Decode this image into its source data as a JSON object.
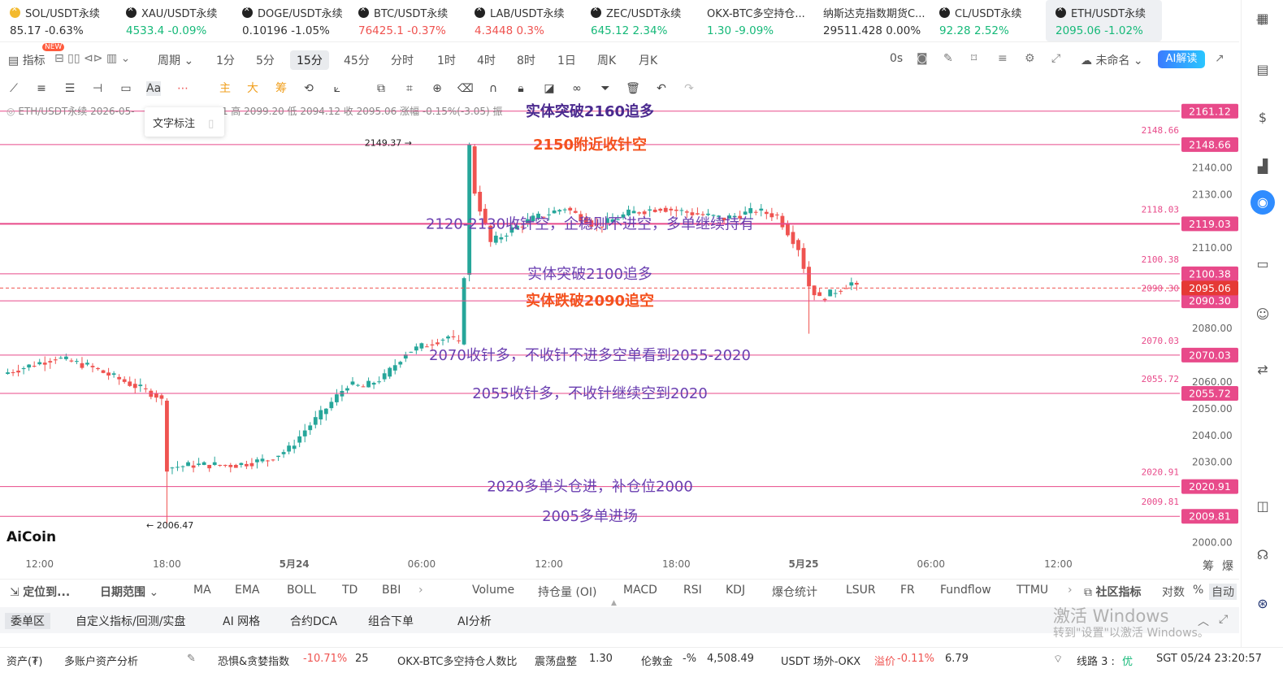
{
  "tickers": [
    {
      "name": "SOL/USDT永续",
      "price": "85.17",
      "change": "-0.63%",
      "color": "#333333",
      "icon": "sol-coin-icon"
    },
    {
      "name": "XAU/USDT永续",
      "price": "4533.4",
      "change": "-0.09%",
      "color": "#16b979",
      "icon": "okx-coin-icon"
    },
    {
      "name": "DOGE/USDT永续",
      "price": "0.10196",
      "change": "-1.05%",
      "color": "#333333",
      "icon": "okx-coin-icon"
    },
    {
      "name": "BTC/USDT永续",
      "price": "76425.1",
      "change": "-0.37%",
      "color": "#ef5350",
      "icon": "okx-coin-icon"
    },
    {
      "name": "LAB/USDT永续",
      "price": "4.3448",
      "change": "0.3%",
      "color": "#ef5350",
      "icon": "okx-coin-icon"
    },
    {
      "name": "ZEC/USDT永续",
      "price": "645.12",
      "change": "2.34%",
      "color": "#16b979",
      "icon": "okx-coin-icon"
    },
    {
      "name": "OKX-BTC多空持仓...",
      "price": "1.30",
      "change": "-9.09%",
      "color": "#16b979",
      "icon": ""
    },
    {
      "name": "纳斯达克指数期货C...",
      "price": "29511.428",
      "change": "0.00%",
      "color": "#333333",
      "icon": ""
    },
    {
      "name": "CL/USDT永续",
      "price": "92.28",
      "change": "2.52%",
      "color": "#16b979",
      "icon": "okx-coin-icon"
    },
    {
      "name": "ETH/USDT永续",
      "price": "2095.06",
      "change": "-1.02%",
      "color": "#16b979",
      "icon": "okx-coin-icon",
      "active": true
    }
  ],
  "toolbar": {
    "indicators": "指标",
    "new_badge": "NEW",
    "period": "周期",
    "intervals": [
      "1分",
      "5分",
      "15分",
      "45分",
      "分时",
      "1时",
      "4时",
      "8时",
      "1日",
      "周K",
      "月K"
    ],
    "selected_interval": "15分",
    "countdown": "0s",
    "layout_name": "未命名",
    "ai_button": "AI解读"
  },
  "legend": {
    "text": "ETH/USDT永续  2026-05-",
    "ohlc": ".11 高 2099.20  低 2094.12  收 2095.06  涨幅 -0.15%(-3.05)  振"
  },
  "popup": {
    "label": "文字标注"
  },
  "chart_data": {
    "type": "candlestick",
    "symbol": "ETH/USDT永续",
    "interval": "15分",
    "ylim": [
      1995,
      2165
    ],
    "y_ticks": [
      2000,
      2010,
      2020,
      2030,
      2040,
      2050,
      2060,
      2070,
      2080,
      2090,
      2100,
      2110,
      2120,
      2130,
      2140
    ],
    "x_ticks": [
      {
        "label": "12:00",
        "bar": 7
      },
      {
        "label": "18:00",
        "bar": 31
      },
      {
        "label": "5月24",
        "bar": 55
      },
      {
        "label": "06:00",
        "bar": 79
      },
      {
        "label": "12:00",
        "bar": 103
      },
      {
        "label": "18:00",
        "bar": 127
      },
      {
        "label": "5月25",
        "bar": 151
      },
      {
        "label": "06:00",
        "bar": 175
      },
      {
        "label": "12:00",
        "bar": 199
      }
    ],
    "bars_visible": 216,
    "price_levels": [
      {
        "value": 2161.12,
        "label": "2161.12"
      },
      {
        "value": 2148.66,
        "label": "2148.66",
        "side_label": "2148.66"
      },
      {
        "value": 2119.03,
        "label": "2119.03",
        "side_label": "2118.03"
      },
      {
        "value": 2100.38,
        "label": "2100.38",
        "side_label": "2100.38"
      },
      {
        "value": 2090.3,
        "label": "2090.30"
      },
      {
        "value": 2070.03,
        "label": "2070.03",
        "side_label": "2070.03"
      },
      {
        "value": 2055.72,
        "label": "2055.72",
        "side_label": "2055.72"
      },
      {
        "value": 2020.91,
        "label": "2020.91",
        "side_label": "2020.91"
      },
      {
        "value": 2009.81,
        "label": "2009.81",
        "side_label": "2009.81"
      }
    ],
    "current_price": {
      "value": 2095.06,
      "label": "2095.06",
      "side_label": "2090.30"
    },
    "annotations": [
      {
        "text": "实体突破2160追多",
        "price": 2161.12,
        "color": "#4b2a8f"
      },
      {
        "text": "2150附近收针空",
        "price": 2148.66,
        "color": "#f4511e"
      },
      {
        "text": "2120-2130收针空，企稳则不进空，多单继续持有",
        "price": 2119.03,
        "color": "#6a3fb0"
      },
      {
        "text": "实体突破2100追多",
        "price": 2100.38,
        "color": "#6a3fb0"
      },
      {
        "text": "实体跌破2090追空",
        "price": 2090.3,
        "color": "#f4511e"
      },
      {
        "text": "2070收针多，不收针不进多空单看到2055-2020",
        "price": 2070.03,
        "color": "#6a3fb0"
      },
      {
        "text": "2055收针多，不收针继续空到2020",
        "price": 2055.72,
        "color": "#6a3fb0"
      },
      {
        "text": "2020多单头仓进，补仓位2000",
        "price": 2020.91,
        "color": "#6a3fb0"
      },
      {
        "text": "2005多单进场",
        "price": 2009.81,
        "color": "#6a3fb0"
      }
    ],
    "marks": [
      {
        "text": "2149.37",
        "price": 2149.37
      },
      {
        "text": "2006.47",
        "price": 2006.47
      }
    ],
    "key_points": [
      [
        0,
        2063
      ],
      [
        10,
        2069
      ],
      [
        16,
        2066
      ],
      [
        22,
        2061
      ],
      [
        29,
        2055
      ],
      [
        30,
        2053
      ],
      [
        31,
        2028
      ],
      [
        36,
        2029
      ],
      [
        44,
        2029
      ],
      [
        50,
        2031
      ],
      [
        54,
        2035
      ],
      [
        57,
        2042
      ],
      [
        60,
        2048
      ],
      [
        65,
        2059
      ],
      [
        68,
        2058
      ],
      [
        72,
        2062
      ],
      [
        76,
        2071
      ],
      [
        80,
        2074
      ],
      [
        84,
        2077
      ],
      [
        86,
        2074
      ],
      [
        87,
        2100
      ],
      [
        88,
        2148
      ],
      [
        89,
        2131
      ],
      [
        92,
        2112
      ],
      [
        96,
        2117
      ],
      [
        100,
        2121
      ],
      [
        106,
        2125
      ],
      [
        112,
        2118
      ],
      [
        118,
        2123
      ],
      [
        124,
        2125
      ],
      [
        130,
        2123
      ],
      [
        136,
        2121
      ],
      [
        142,
        2124
      ],
      [
        146,
        2122
      ],
      [
        150,
        2110
      ],
      [
        152,
        2096
      ],
      [
        154,
        2091
      ],
      [
        157,
        2094
      ],
      [
        160,
        2097
      ],
      [
        161,
        2095
      ]
    ],
    "colors": {
      "up": "#26a69a",
      "down": "#ef5350",
      "level": "#e84a8a",
      "level_label_bg": "#e84a8a"
    }
  },
  "logo": "AiCoin",
  "indicator_bar": {
    "locate": "定位到...",
    "date_range": "日期范围",
    "main_indicators": [
      "MA",
      "EMA",
      "BOLL",
      "TD",
      "BBI"
    ],
    "sub_indicators": [
      "Volume",
      "持仓量 (OI)",
      "MACD",
      "RSI",
      "KDJ",
      "爆仓统计",
      "LSUR",
      "FR",
      "Fundflow",
      "TTMU"
    ],
    "community": "社区指标",
    "log": "对数",
    "percent": "%",
    "auto": "自动",
    "right_axis_labels": [
      "筹",
      "爆"
    ]
  },
  "panel_bar": {
    "tabs": [
      "委单区",
      "自定义指标/回测/实盘",
      "AI 网格",
      "合约DCA",
      "组合下单",
      "AI分析"
    ]
  },
  "watermark": {
    "line1": "激活 Windows",
    "line2": "转到\"设置\"以激活 Windows。"
  },
  "status_bar": {
    "assets": "资产(₮)",
    "multi_account": "多账户资产分析",
    "fear_greed_label": "恐惧&贪婪指数",
    "fear_greed_change": "-10.71%",
    "fear_greed_value": "25",
    "ls_ratio_label": "OKX-BTC多空持仓人数比",
    "ls_state": "震荡盘整",
    "ls_value": "1.30",
    "gold_label": "伦敦金",
    "gold_change": "-%",
    "gold_value": "4,508.49",
    "usdt_label": "USDT 场外-OKX",
    "premium_label": "溢价",
    "premium_value": "-0.11%",
    "usdt_value": "6.79",
    "line_label": "线路 3 :",
    "line_state": "优",
    "clock": "SGT 05/24 23:20:57"
  }
}
